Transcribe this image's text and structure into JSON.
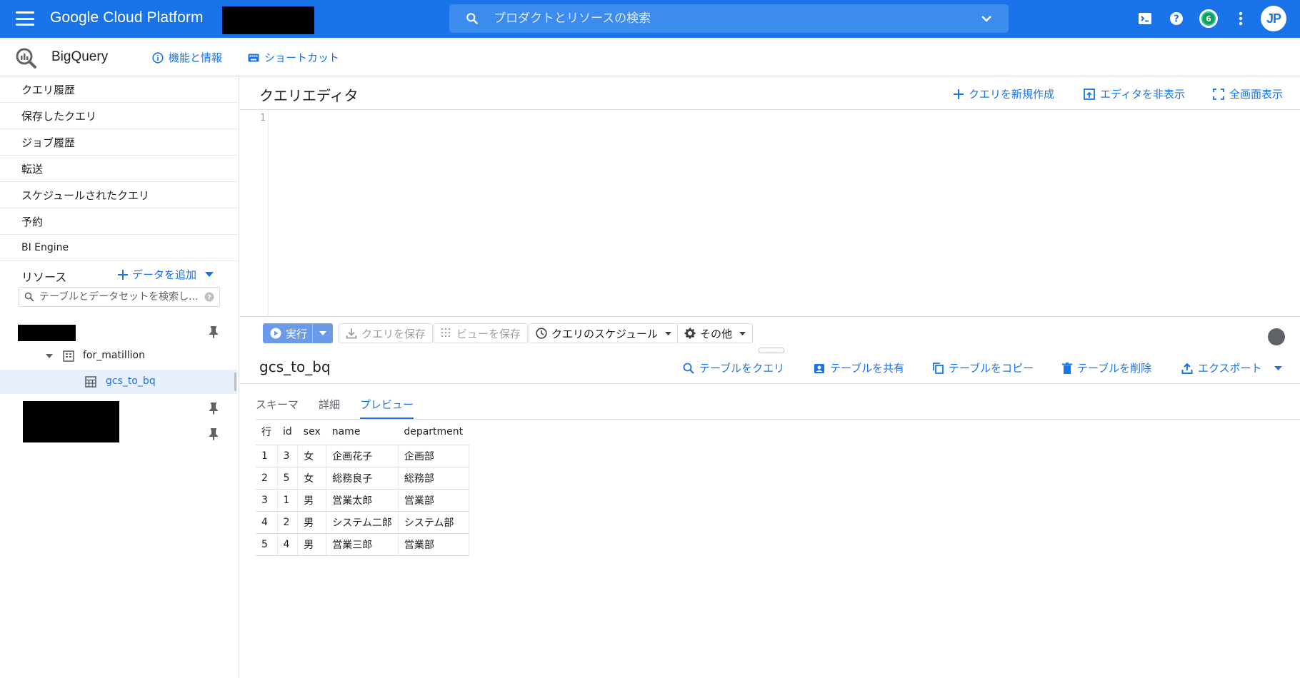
{
  "topbar": {
    "product_title": "Google Cloud Platform",
    "search_placeholder": "プロダクトとリソースの検索",
    "notification_count": "6",
    "avatar_initials": "JP",
    "accent_color": "#1a73e8"
  },
  "subheader": {
    "app_name": "BigQuery",
    "features_link": "機能と情報",
    "shortcuts_link": "ショートカット"
  },
  "sidebar": {
    "items": [
      {
        "label": "クエリ履歴"
      },
      {
        "label": "保存したクエリ"
      },
      {
        "label": "ジョブ履歴"
      },
      {
        "label": "転送"
      },
      {
        "label": "スケジュールされたクエリ"
      },
      {
        "label": "予約"
      },
      {
        "label": "BI Engine"
      }
    ],
    "resources_label": "リソース",
    "add_data_label": "データを追加",
    "resource_search_placeholder": "テーブルとデータセットを検索し...",
    "dataset_name": "for_matillion",
    "table_name": "gcs_to_bq"
  },
  "editor": {
    "title": "クエリエディタ",
    "new_query": "クエリを新規作成",
    "hide_editor": "エディタを非表示",
    "fullscreen": "全画面表示",
    "line_number": "1"
  },
  "toolbar": {
    "run": "実行",
    "save_query": "クエリを保存",
    "save_view": "ビューを保存",
    "schedule": "クエリのスケジュール",
    "more": "その他"
  },
  "table_panel": {
    "title": "gcs_to_bq",
    "actions": {
      "query": "テーブルをクエリ",
      "share": "テーブルを共有",
      "copy": "テーブルをコピー",
      "delete": "テーブルを削除",
      "export": "エクスポート"
    },
    "tabs": [
      {
        "label": "スキーマ"
      },
      {
        "label": "詳細"
      },
      {
        "label": "プレビュー"
      }
    ],
    "columns": [
      "行",
      "id",
      "sex",
      "name",
      "department"
    ],
    "rows": [
      [
        "1",
        "3",
        "女",
        "企画花子",
        "企画部"
      ],
      [
        "2",
        "5",
        "女",
        "総務良子",
        "総務部"
      ],
      [
        "3",
        "1",
        "男",
        "営業太郎",
        "営業部"
      ],
      [
        "4",
        "2",
        "男",
        "システム二郎",
        "システム部"
      ],
      [
        "5",
        "4",
        "男",
        "営業三郎",
        "営業部"
      ]
    ]
  }
}
